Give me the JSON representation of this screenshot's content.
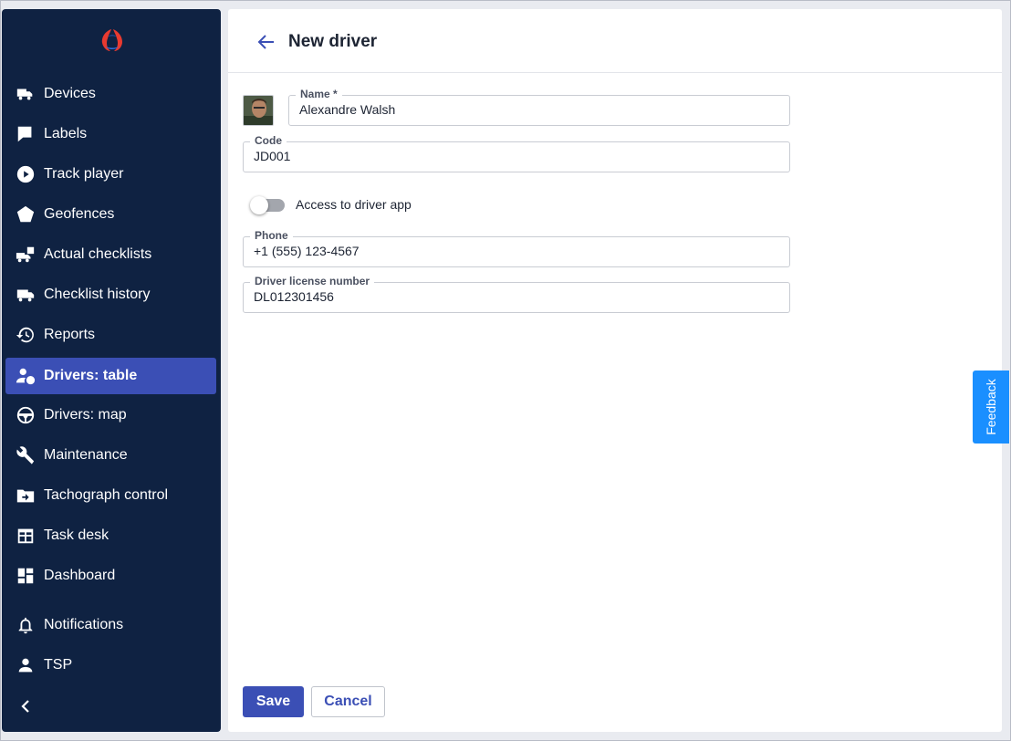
{
  "sidebar": {
    "items": [
      {
        "label": "Devices",
        "icon": "truck-car-icon"
      },
      {
        "label": "Labels",
        "icon": "label-flag-icon"
      },
      {
        "label": "Track player",
        "icon": "play-circle-icon"
      },
      {
        "label": "Geofences",
        "icon": "pentagon-icon"
      },
      {
        "label": "Actual checklists",
        "icon": "truck-checklist-icon"
      },
      {
        "label": "Checklist history",
        "icon": "truck-history-icon"
      },
      {
        "label": "Reports",
        "icon": "history-icon"
      },
      {
        "label": "Drivers: table",
        "icon": "driver-wheel-icon",
        "active": true
      },
      {
        "label": "Drivers: map",
        "icon": "steering-wheel-icon"
      },
      {
        "label": "Maintenance",
        "icon": "wrench-icon"
      },
      {
        "label": "Tachograph control",
        "icon": "folder-arrow-icon"
      },
      {
        "label": "Task desk",
        "icon": "calendar-table-icon"
      },
      {
        "label": "Dashboard",
        "icon": "dashboard-icon"
      },
      {
        "label": "Notifications",
        "icon": "bell-icon"
      },
      {
        "label": "TSP",
        "icon": "person-icon"
      }
    ]
  },
  "header": {
    "title": "New driver"
  },
  "form": {
    "name": {
      "label": "Name *",
      "value": "Alexandre Walsh"
    },
    "code": {
      "label": "Code",
      "value": "JD001"
    },
    "access": {
      "label": "Access to driver app",
      "enabled": false
    },
    "phone": {
      "label": "Phone",
      "value": "+1 (555) 123-4567"
    },
    "license": {
      "label": "Driver license number",
      "value": "DL012301456"
    }
  },
  "actions": {
    "save": "Save",
    "cancel": "Cancel"
  },
  "feedback": {
    "label": "Feedback"
  },
  "colors": {
    "sidebar": "#0f2242",
    "accent": "#3b4fb5",
    "feedback": "#1a8fff"
  }
}
